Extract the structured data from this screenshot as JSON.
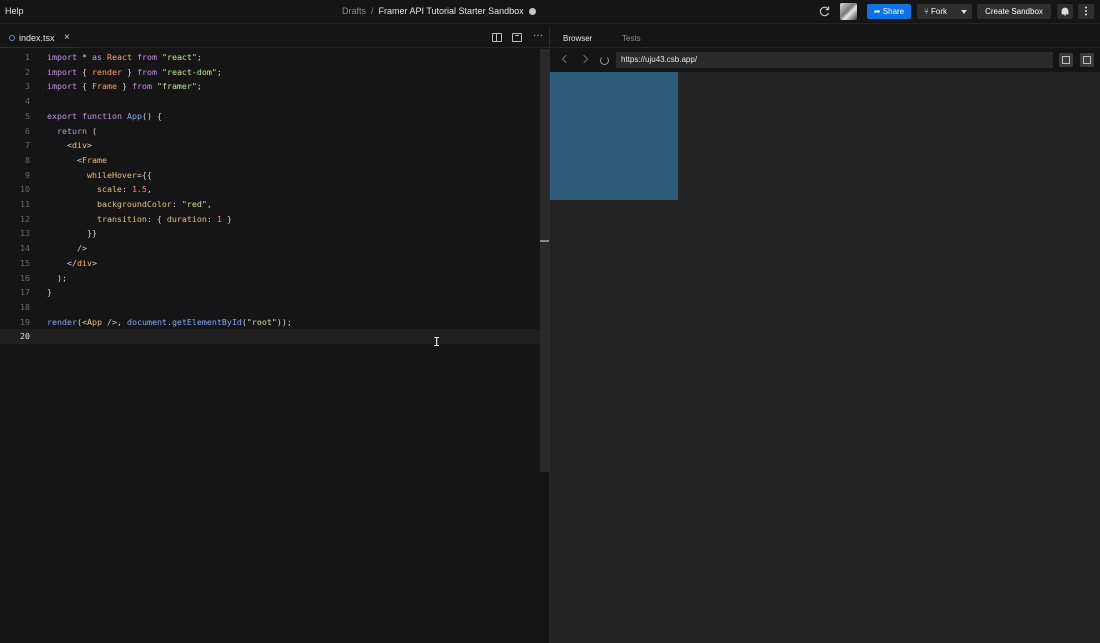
{
  "topbar": {
    "menu_help": "Help",
    "breadcrumb_parent": "Drafts",
    "breadcrumb_sep": "/",
    "sandbox_title": "Framer API Tutorial Starter Sandbox",
    "share_label": "Share",
    "fork_label": "Fork",
    "create_sandbox_label": "Create Sandbox"
  },
  "editor": {
    "file_tab": "index.tsx",
    "close_glyph": "×",
    "more_glyph": "···",
    "active_line": 20,
    "lines": [
      {
        "n": "1",
        "code": "import * as React from \"react\";"
      },
      {
        "n": "2",
        "code": "import { render } from \"react-dom\";"
      },
      {
        "n": "3",
        "code": "import { Frame } from \"framer\";"
      },
      {
        "n": "4",
        "code": ""
      },
      {
        "n": "5",
        "code": "export function App() {"
      },
      {
        "n": "6",
        "code": "  return ("
      },
      {
        "n": "7",
        "code": "    <div>"
      },
      {
        "n": "8",
        "code": "      <Frame"
      },
      {
        "n": "9",
        "code": "        whileHover={{"
      },
      {
        "n": "10",
        "code": "          scale: 1.5,"
      },
      {
        "n": "11",
        "code": "          backgroundColor: \"red\","
      },
      {
        "n": "12",
        "code": "          transition: { duration: 1 }"
      },
      {
        "n": "13",
        "code": "        }}"
      },
      {
        "n": "14",
        "code": "      />"
      },
      {
        "n": "15",
        "code": "    </div>"
      },
      {
        "n": "16",
        "code": "  );"
      },
      {
        "n": "17",
        "code": "}"
      },
      {
        "n": "18",
        "code": ""
      },
      {
        "n": "19",
        "code": "render(<App />, document.getElementById(\"root\"));"
      },
      {
        "n": "20",
        "code": ""
      }
    ]
  },
  "panel": {
    "tab_browser": "Browser",
    "tab_tests": "Tests",
    "url": "https://uju43.csb.app/"
  },
  "colors": {
    "share_button": "#0d72e8",
    "preview_frame": "#2d5b7a",
    "editor_bg": "#151515",
    "preview_bg": "#242424"
  }
}
